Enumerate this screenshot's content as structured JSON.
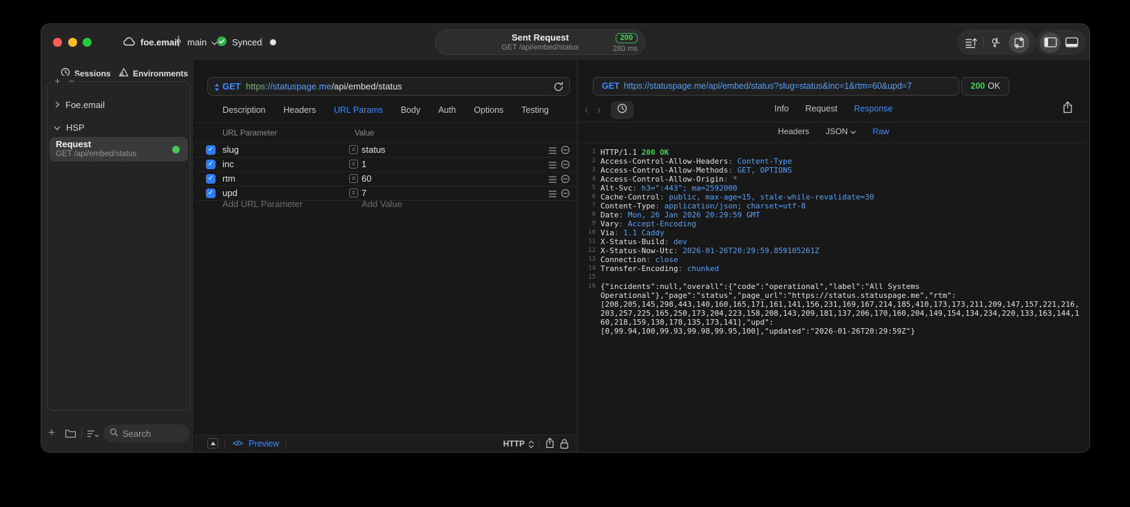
{
  "titlebar": {
    "project": "foe.email",
    "branch": "main",
    "sync_label": "Synced",
    "request_summary": {
      "title": "Sent Request",
      "subtitle": "GET /api/embed/status",
      "status_code": "200",
      "duration": "280 ms"
    }
  },
  "sidebar": {
    "tabs": [
      {
        "label": "Sessions",
        "icon": "clock-icon"
      },
      {
        "label": "Environments",
        "icon": "environments-icon"
      }
    ],
    "tree": [
      {
        "label": "Foe.email",
        "expanded": false
      },
      {
        "label": "HSP",
        "expanded": true
      }
    ],
    "request_item": {
      "title": "Request",
      "subtitle": "GET /api/embed/status",
      "selected": true,
      "status_dot_color": "#4cc45a"
    },
    "search_placeholder": "Search"
  },
  "request_editor": {
    "method": "GET",
    "url": {
      "scheme": "https",
      "host": "://statuspage.me",
      "path": "/api/embed/status"
    },
    "tabs": [
      "Description",
      "Headers",
      "URL Params",
      "Body",
      "Auth",
      "Options",
      "Testing"
    ],
    "active_tab": "URL Params",
    "params": {
      "columns": [
        "URL Parameter",
        "Value"
      ],
      "rows": [
        {
          "enabled": true,
          "name": "slug",
          "value": "status"
        },
        {
          "enabled": true,
          "name": "inc",
          "value": "1"
        },
        {
          "enabled": true,
          "name": "rtm",
          "value": "60"
        },
        {
          "enabled": true,
          "name": "upd",
          "value": "7"
        }
      ],
      "add_name_placeholder": "Add URL Parameter",
      "add_value_placeholder": "Add Value"
    },
    "footer": {
      "code_glyph": "</>",
      "preview_label": "Preview",
      "protocol": "HTTP"
    }
  },
  "response_viewer": {
    "method": "GET",
    "url": "https://statuspage.me/api/embed/status?slug=status&inc=1&rtm=60&upd=7",
    "status_code": "200",
    "status_text": "OK",
    "tabs": [
      "Info",
      "Request",
      "Response"
    ],
    "active_tab": "Response",
    "subtabs": [
      {
        "label": "Headers",
        "has_menu": false
      },
      {
        "label": "JSON",
        "has_menu": true
      },
      {
        "label": "Raw",
        "has_menu": false
      }
    ],
    "active_subtab": "Raw",
    "raw": {
      "status_line": {
        "protocol": "HTTP/1.1",
        "status": "200 OK"
      },
      "headers": [
        {
          "name": "Access-Control-Allow-Headers",
          "value": "Content-Type"
        },
        {
          "name": "Access-Control-Allow-Methods",
          "value": "GET, OPTIONS"
        },
        {
          "name": "Access-Control-Allow-Origin",
          "value": "*"
        },
        {
          "name": "Alt-Svc",
          "value": "h3=\":443\"; ma=2592000"
        },
        {
          "name": "Cache-Control",
          "value": "public, max-age=15, stale-while-revalidate=30"
        },
        {
          "name": "Content-Type",
          "value": "application/json; charset=utf-8"
        },
        {
          "name": "Date",
          "value": "Mon, 26 Jan 2026 20:29:59 GMT"
        },
        {
          "name": "Vary",
          "value": "Accept-Encoding"
        },
        {
          "name": "Via",
          "value": "1.1 Caddy"
        },
        {
          "name": "X-Status-Build",
          "value": "dev"
        },
        {
          "name": "X-Status-Now-Utc",
          "value": "2026-01-26T20:29:59.859105261Z"
        },
        {
          "name": "Connection",
          "value": "close"
        },
        {
          "name": "Transfer-Encoding",
          "value": "chunked"
        }
      ],
      "body_lines": [
        "{\"incidents\":null,\"overall\":{\"code\":\"operational\",\"label\":\"All Systems",
        "Operational\"},\"page\":\"status\",\"page_url\":\"https://status.statuspage.me\",\"rtm\":",
        "[208,205,145,298,443,140,160,165,171,161,141,156,231,169,167,214,185,410,173,173,211,209,147,157,221,216,",
        "203,257,225,165,250,173,204,223,158,208,143,209,181,137,206,170,160,204,149,154,134,234,220,133,163,144,1",
        "60,218,159,138,178,135,173,141],\"upd\":",
        "[0,99.94,100,99.93,99.98,99.95,100],\"updated\":\"2026-01-26T20:29:59Z\"}"
      ]
    }
  },
  "colors": {
    "accent_blue": "#3e8bff",
    "status_green": "#3ecf53",
    "checkbox_blue": "#2e7df0",
    "scheme_green": "#79b974",
    "traffic_red": "#ff5f57",
    "traffic_yellow": "#febc2e",
    "traffic_green": "#28c840"
  }
}
